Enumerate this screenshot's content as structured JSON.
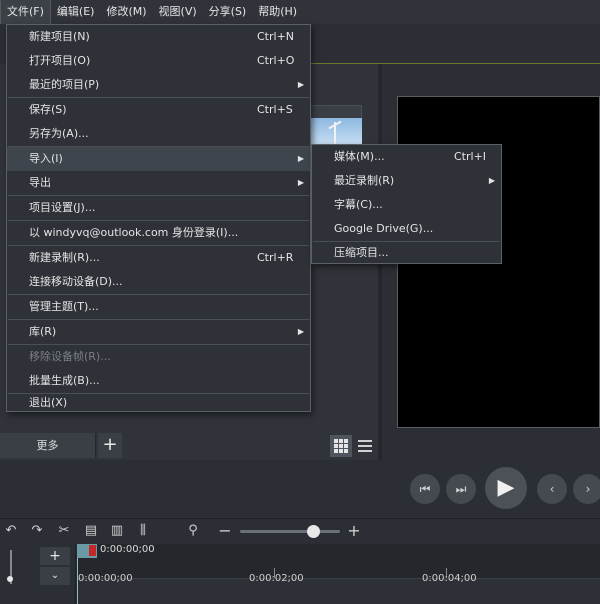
{
  "menubar": {
    "items": [
      {
        "label": "文件(F)"
      },
      {
        "label": "编辑(E)"
      },
      {
        "label": "修改(M)"
      },
      {
        "label": "视图(V)"
      },
      {
        "label": "分享(S)"
      },
      {
        "label": "帮助(H)"
      }
    ]
  },
  "file_menu": {
    "items": [
      {
        "label": "新建项目(N)",
        "shortcut": "Ctrl+N"
      },
      {
        "label": "打开项目(O)",
        "shortcut": "Ctrl+O"
      },
      {
        "label": "最近的项目(P)",
        "has_submenu": true
      },
      {
        "label": "保存(S)",
        "shortcut": "Ctrl+S"
      },
      {
        "label": "另存为(A)..."
      },
      {
        "label": "导入(I)",
        "has_submenu": true,
        "highlighted": true
      },
      {
        "label": "导出",
        "has_submenu": true
      },
      {
        "label": "项目设置(J)..."
      },
      {
        "label": "以 windyvq@outlook.com 身份登录(I)..."
      },
      {
        "label": "新建录制(R)...",
        "shortcut": "Ctrl+R"
      },
      {
        "label": "连接移动设备(D)..."
      },
      {
        "label": "管理主题(T)..."
      },
      {
        "label": "库(R)",
        "has_submenu": true
      },
      {
        "label": "移除设备帧(R)...",
        "disabled": true
      },
      {
        "label": "批量生成(B)..."
      },
      {
        "label": "退出(X)"
      }
    ]
  },
  "import_submenu": {
    "items": [
      {
        "label": "媒体(M)...",
        "shortcut": "Ctrl+I"
      },
      {
        "label": "最近录制(R)",
        "has_submenu": true
      },
      {
        "label": "字幕(C)..."
      },
      {
        "label": "Google Drive(G)..."
      },
      {
        "label": "压缩项目..."
      }
    ]
  },
  "media_bin": {
    "more_label": "更多",
    "add_symbol": "+"
  },
  "timeline": {
    "current_time": "0:00:00;00",
    "ruler_labels": [
      "0:00:00;00",
      "0:00:02;00",
      "0:00:04;00"
    ],
    "zoom_level": 0.67
  },
  "icons": {
    "submenu_arrow": "▶",
    "undo": "↶",
    "redo": "↷",
    "play": "▶",
    "zoom_minus": "−",
    "zoom_plus": "+"
  },
  "colors": {
    "accent_line": "#6a7a2e",
    "playhead": "#6b9aa5",
    "playhead_marker": "#c0282a"
  }
}
